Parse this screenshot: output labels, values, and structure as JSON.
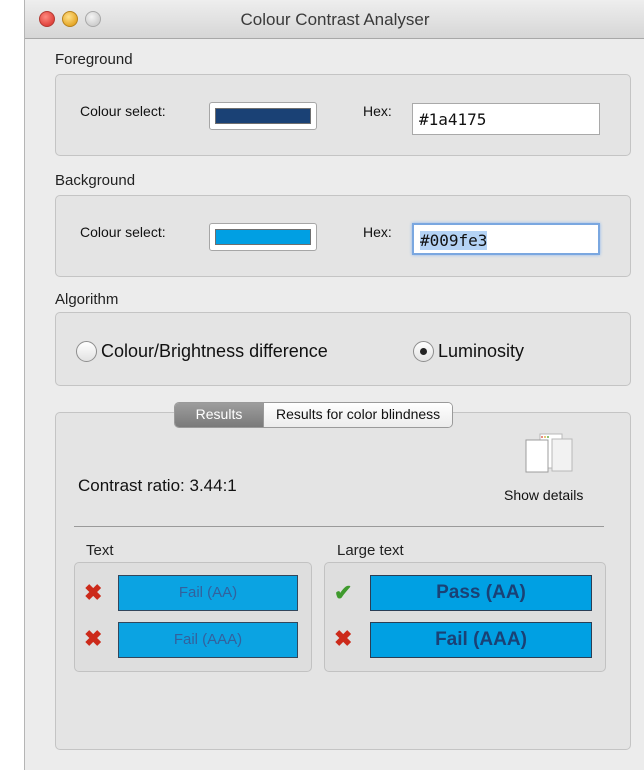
{
  "window": {
    "title": "Colour Contrast Analyser"
  },
  "foreground": {
    "section_label": "Foreground",
    "colour_select_label": "Colour select:",
    "hex_label": "Hex:",
    "hex_value": "#1a4175",
    "swatch_color": "#1a4175"
  },
  "background": {
    "section_label": "Background",
    "colour_select_label": "Colour select:",
    "hex_label": "Hex:",
    "hex_value": "#009fe3",
    "swatch_color": "#009fe3"
  },
  "algorithm": {
    "section_label": "Algorithm",
    "options": [
      {
        "label": "Colour/Brightness difference",
        "selected": false
      },
      {
        "label": "Luminosity",
        "selected": true
      }
    ]
  },
  "results": {
    "tabs": [
      {
        "label": "Results",
        "active": true
      },
      {
        "label": "Results for color blindness",
        "active": false
      }
    ],
    "contrast_ratio": "Contrast ratio: 3.44:1",
    "show_details_label": "Show details",
    "text_group": {
      "label": "Text",
      "items": [
        {
          "status": "fail",
          "icon": "cross-icon",
          "label": "Fail (AA)"
        },
        {
          "status": "fail",
          "icon": "cross-icon",
          "label": "Fail (AAA)"
        }
      ]
    },
    "large_text_group": {
      "label": "Large text",
      "items": [
        {
          "status": "pass",
          "icon": "check-icon",
          "label": "Pass (AA)"
        },
        {
          "status": "fail",
          "icon": "cross-icon",
          "label": "Fail (AAA)"
        }
      ]
    }
  },
  "colors": {
    "fail": "#cc2a1a",
    "pass": "#3f9a2d"
  }
}
